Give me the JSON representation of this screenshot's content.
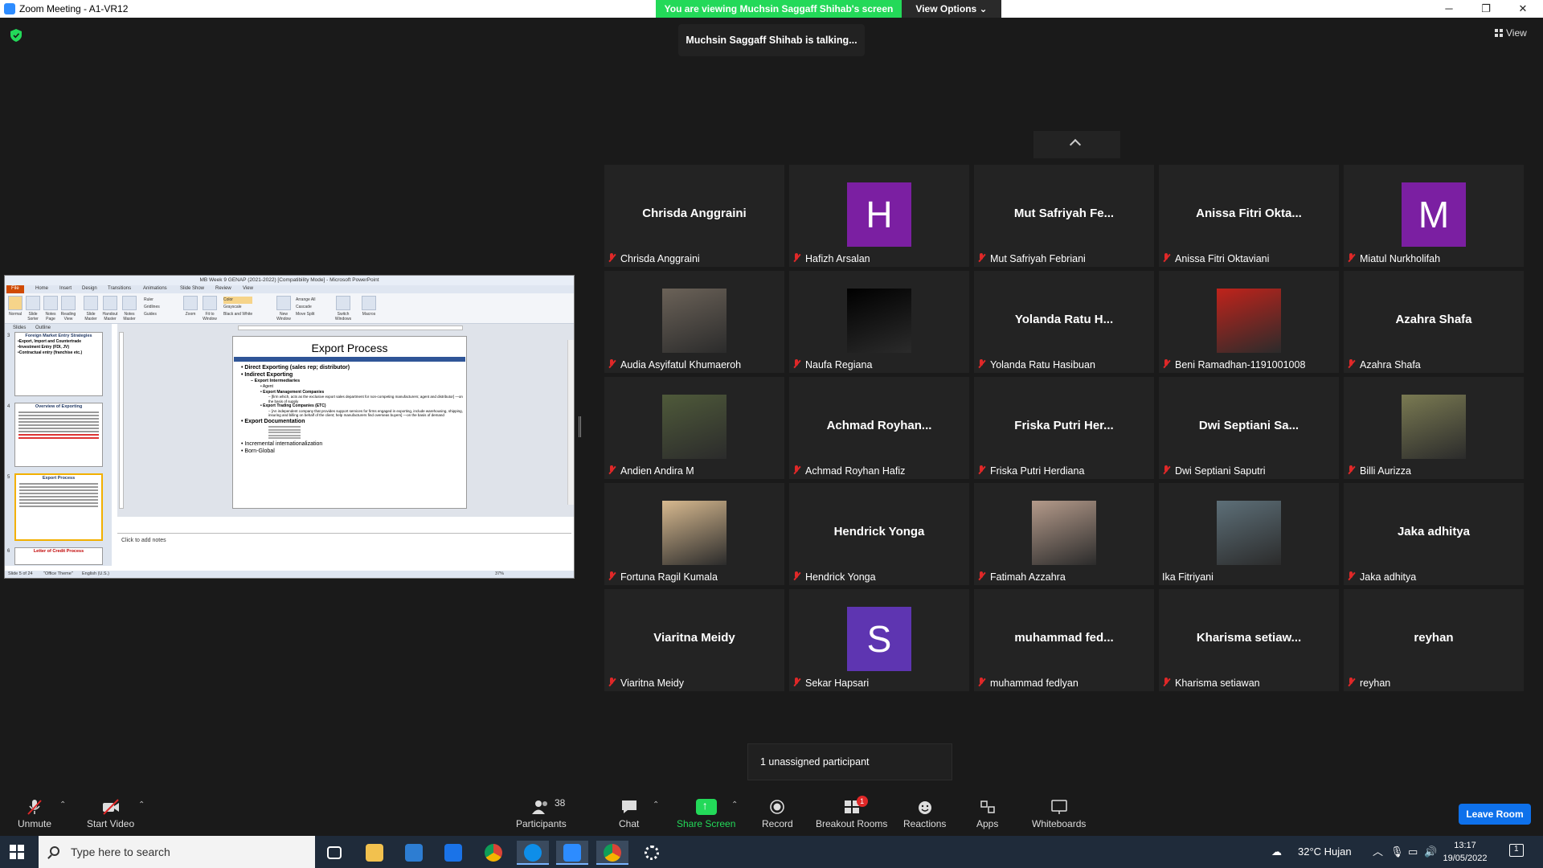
{
  "window": {
    "title": "Zoom Meeting - A1-VR12",
    "minimize": "─",
    "maximize": "❐",
    "close": "✕"
  },
  "banner": {
    "viewing": "You are viewing Muchsin Saggaff Shihab's screen",
    "view_options": "View Options ⌄"
  },
  "talking_indicator": "Muchsin Saggaff Shihab is talking...",
  "view_button": "View",
  "shared_screen": {
    "window_title": "MB Week 9 GENAP (2021-2022) [Compatibility Mode] - Microsoft PowerPoint",
    "ribbon_tabs": [
      "File",
      "Home",
      "Insert",
      "Design",
      "Transitions",
      "Animations",
      "Slide Show",
      "Review",
      "View"
    ],
    "ribbon_buttons": [
      "Normal",
      "Slide Sorter",
      "Notes Page",
      "Reading View",
      "Slide Master",
      "Handout Master",
      "Notes Master",
      "Zoom",
      "Fit to Window",
      "New Window",
      "Switch Windows",
      "Macros"
    ],
    "ribbon_checks": [
      "Ruler",
      "Gridlines",
      "Guides"
    ],
    "ribbon_color": [
      "Color",
      "Grayscale",
      "Black and White"
    ],
    "ribbon_window": [
      "Arrange All",
      "Cascade",
      "Move Split"
    ],
    "panel_tabs": [
      "Slides",
      "Outline"
    ],
    "thumbnails": [
      {
        "num": "3",
        "title": "Foreign Market Entry Strategies",
        "lines": [
          "•Export, Import and Countertrade",
          "•Investment Entry (FDI, JV)",
          "•Contractual entry (franchise etc.)"
        ]
      },
      {
        "num": "4",
        "title": "Overview of Exporting",
        "lines": []
      },
      {
        "num": "5",
        "title": "Export Process",
        "lines": []
      },
      {
        "num": "6",
        "title": "Letter of Credit Process",
        "lines": []
      }
    ],
    "slide": {
      "title": "Export Process",
      "items": [
        {
          "level": 1,
          "bold": true,
          "text": "Direct Exporting  (sales rep; distributor)"
        },
        {
          "level": 1,
          "bold": true,
          "text": "Indirect Exporting"
        },
        {
          "level": 2,
          "bold": true,
          "text": "Export Intermediaries"
        },
        {
          "level": 3,
          "bold": false,
          "text": "Agent"
        },
        {
          "level": 3,
          "bold": true,
          "text": "Export Management Companies"
        },
        {
          "level": 4,
          "bold": false,
          "text": "– [firm which, acts as the exclusive export sales department for non-competing manufacturers; agent and distributor] —on the basis of supply"
        },
        {
          "level": 3,
          "bold": true,
          "text": "Export Trading Companies (ETC)"
        },
        {
          "level": 4,
          "bold": false,
          "text": "– [An independent company that provides support services for firms engaged in exporting, include warehousing, shipping, insuring and billing on behalf of the client; help manufacturers find overseas buyers] —on the basis of demand"
        },
        {
          "level": 1,
          "bold": true,
          "text": "Export Documentation"
        },
        {
          "level": 1,
          "bold": false,
          "text": "Incremental internationalization"
        },
        {
          "level": 1,
          "bold": false,
          "text": "Born-Global"
        }
      ]
    },
    "notes_placeholder": "Click to add notes",
    "status": {
      "slide": "Slide 5 of 24",
      "theme": "\"Office Theme\"",
      "language": "English (U.S.)",
      "zoom": "37%"
    }
  },
  "participants": [
    {
      "display": "Chrisda Anggraini",
      "name": "Chrisda Anggraini",
      "type": "text",
      "muted": true
    },
    {
      "display": "H",
      "name": "Hafizh Arsalan",
      "type": "avatar",
      "color": "#7b1fa2",
      "muted": true
    },
    {
      "display": "Mut Safriyah Fe...",
      "name": "Mut Safriyah Febriani",
      "type": "text",
      "muted": true
    },
    {
      "display": "Anissa Fitri Okta...",
      "name": "Anissa Fitri Oktaviani",
      "type": "text",
      "muted": true
    },
    {
      "display": "M",
      "name": "Miatul Nurkholifah",
      "type": "avatar",
      "color": "#7b1fa2",
      "muted": true
    },
    {
      "display": "",
      "name": "Audia Asyifatul Khumaeroh",
      "type": "photo",
      "color": "#6b6258",
      "muted": true
    },
    {
      "display": "",
      "name": "Naufa Regiana",
      "type": "photo",
      "color": "#000000",
      "muted": true
    },
    {
      "display": "Yolanda Ratu H...",
      "name": "Yolanda Ratu Hasibuan",
      "type": "text",
      "muted": true
    },
    {
      "display": "",
      "name": "Beni Ramadhan-1191001008",
      "type": "photo",
      "color": "#c0231b",
      "muted": true
    },
    {
      "display": "Azahra Shafa",
      "name": "Azahra Shafa",
      "type": "text",
      "muted": true
    },
    {
      "display": "",
      "name": "Andien Andira M",
      "type": "photo",
      "color": "#4f5a3a",
      "muted": true
    },
    {
      "display": "Achmad  Royhan...",
      "name": "Achmad Royhan Hafiz",
      "type": "text",
      "muted": true
    },
    {
      "display": "Friska Putri Her...",
      "name": "Friska Putri Herdiana",
      "type": "text",
      "muted": true
    },
    {
      "display": "Dwi Septiani Sa...",
      "name": "Dwi Septiani Saputri",
      "type": "text",
      "muted": true
    },
    {
      "display": "",
      "name": "Billi Aurizza",
      "type": "photo",
      "color": "#7a7a52",
      "muted": true
    },
    {
      "display": "",
      "name": "Fortuna Ragil Kumala",
      "type": "photo",
      "color": "#d7b98f",
      "muted": true
    },
    {
      "display": "Hendrick Yonga",
      "name": "Hendrick Yonga",
      "type": "text",
      "muted": true
    },
    {
      "display": "",
      "name": "Fatimah Azzahra",
      "type": "photo",
      "color": "#b49a8a",
      "muted": true
    },
    {
      "display": "",
      "name": "Ika Fitriyani",
      "type": "photo",
      "color": "#5d6f78",
      "muted": false
    },
    {
      "display": "Jaka adhitya",
      "name": "Jaka adhitya",
      "type": "text",
      "muted": true
    },
    {
      "display": "Viaritna Meidy",
      "name": "Viaritna Meidy",
      "type": "text",
      "muted": true
    },
    {
      "display": "S",
      "name": "Sekar Hapsari",
      "type": "avatar",
      "color": "#5e35b1",
      "muted": true
    },
    {
      "display": "muhammad  fed...",
      "name": "muhammad fedlyan",
      "type": "text",
      "muted": true
    },
    {
      "display": "Kharisma  setiaw...",
      "name": "Kharisma setiawan",
      "type": "text",
      "muted": true
    },
    {
      "display": "reyhan",
      "name": "reyhan",
      "type": "text",
      "muted": true
    }
  ],
  "unassigned_popup": "1 unassigned participant",
  "toolbar": {
    "unmute": "Unmute",
    "start_video": "Start Video",
    "participants": "Participants",
    "participants_count": "38",
    "chat": "Chat",
    "share_screen": "Share Screen",
    "record": "Record",
    "breakout_rooms": "Breakout Rooms",
    "breakout_badge": "1",
    "reactions": "Reactions",
    "apps": "Apps",
    "whiteboards": "Whiteboards",
    "leave_room": "Leave Room"
  },
  "taskbar": {
    "search_placeholder": "Type here to search",
    "weather": "32°C  Hujan",
    "time": "13:17",
    "date": "19/05/2022",
    "notification_count": "1"
  }
}
